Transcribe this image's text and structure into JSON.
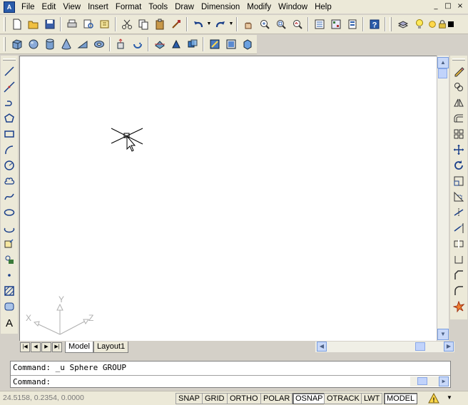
{
  "menu": [
    "File",
    "Edit",
    "View",
    "Insert",
    "Format",
    "Tools",
    "Draw",
    "Dimension",
    "Modify",
    "Window",
    "Help"
  ],
  "window_controls": [
    "_",
    "□",
    "×"
  ],
  "tabs": [
    "Model",
    "Layout1"
  ],
  "command": {
    "history_line": "Command: _u Sphere GROUP",
    "prompt": "Command:"
  },
  "status": {
    "coordinates": "24.5158, 0.2354, 0.0000",
    "toggles": [
      "SNAP",
      "GRID",
      "ORTHO",
      "POLAR",
      "OSNAP",
      "OTRACK",
      "LWT",
      "MODEL"
    ]
  },
  "ucs": {
    "x_label": "X",
    "y_label": "Y",
    "z_label": "Z"
  },
  "colors": {
    "accent": "#2a5caa",
    "canvas": "#ffffff",
    "chrome": "#ece9d8"
  }
}
